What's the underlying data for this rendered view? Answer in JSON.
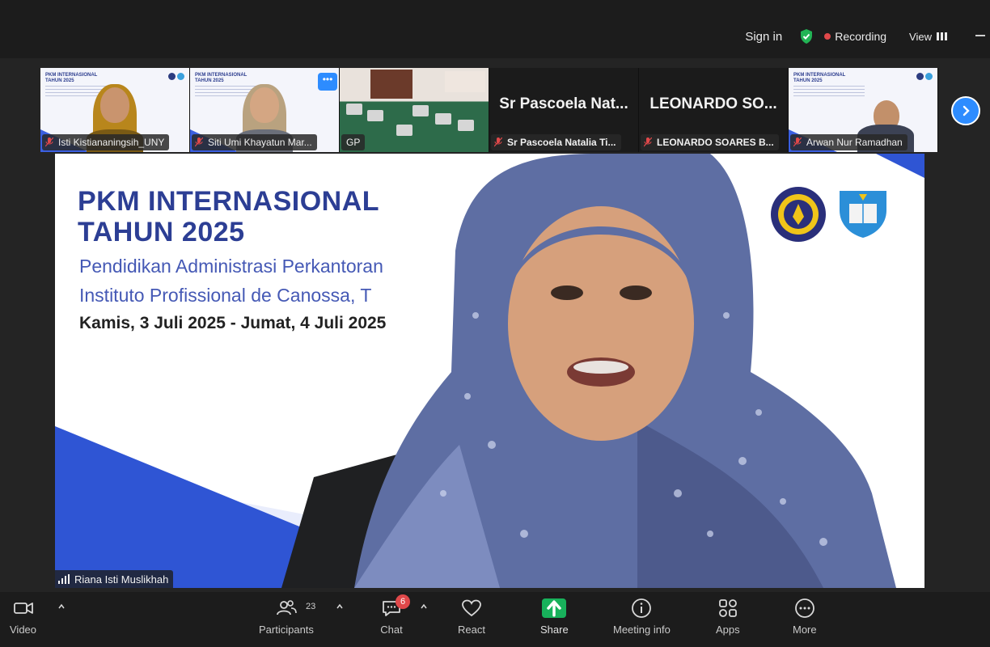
{
  "topbar": {
    "signin": "Sign in",
    "recording": "Recording",
    "view": "View"
  },
  "thumbnails": [
    {
      "name": "Isti Kistiananingsih_UNY",
      "type": "video-slide"
    },
    {
      "name": "Siti Umi Khayatun Mar...",
      "type": "video-slide"
    },
    {
      "name": "GP",
      "type": "video-room"
    },
    {
      "display_name": "Sr  Pascoela  Nat...",
      "name": "Sr Pascoela Natalia Ti...",
      "type": "name-only"
    },
    {
      "display_name": "LEONARDO  SO...",
      "name": "LEONARDO SOARES B...",
      "type": "name-only"
    },
    {
      "name": "Arwan Nur Ramadhan",
      "type": "video-slide"
    }
  ],
  "mini_slide_title": "PKM INTERNASIONAL TAHUN 2025",
  "slide": {
    "title_line1": "PKM INTERNASIONAL",
    "title_line2": "TAHUN 2025",
    "subtitle_line1": "Pendidikan Administrasi Perkantoran",
    "subtitle_line2": "Instituto Profissional de Canossa, T",
    "date": "Kamis, 3 Juli 2025 - Jumat, 4 Juli 2025"
  },
  "active_speaker": "Riana Isti Muslikhah",
  "toolbar": {
    "video": "Video",
    "participants": "Participants",
    "participants_count": "23",
    "chat": "Chat",
    "chat_badge": "6",
    "react": "React",
    "share": "Share",
    "meeting_info": "Meeting info",
    "apps": "Apps",
    "more": "More"
  },
  "colors": {
    "accent": "#2d8cff",
    "share_green": "#18b15b",
    "recording_red": "#e0484a",
    "slide_blue": "#2c3e94"
  }
}
